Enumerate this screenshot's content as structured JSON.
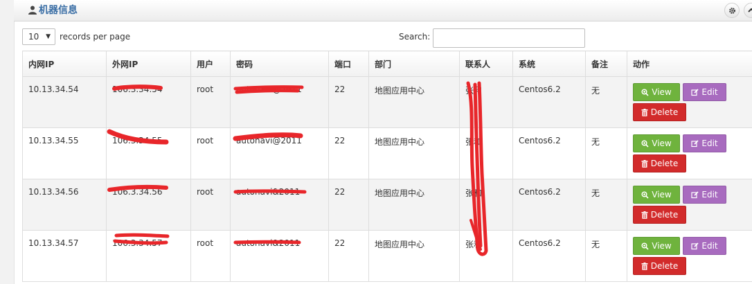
{
  "panel": {
    "title": "机器信息",
    "icon": "user-icon"
  },
  "header_buttons": [
    {
      "name": "gear-icon",
      "glyph": "⚙"
    },
    {
      "name": "chevron-up-icon",
      "glyph": "^"
    }
  ],
  "controls": {
    "length_value": "10",
    "length_label": "records per page",
    "search_label": "Search:",
    "search_value": ""
  },
  "table": {
    "columns": [
      "内网IP",
      "外网IP",
      "用户",
      "密码",
      "端口",
      "部门",
      "联系人",
      "系统",
      "备注",
      "动作"
    ],
    "rows": [
      {
        "internal_ip": "10.13.34.54",
        "external_ip": "106.3.34.54",
        "user": "root",
        "password": "autonavi@2011",
        "port": "22",
        "dept": "地图应用中心",
        "contact": "张和",
        "os": "Centos6.2",
        "note": "无"
      },
      {
        "internal_ip": "10.13.34.55",
        "external_ip": "106.3.34.55",
        "user": "root",
        "password": "autonavi@2011",
        "port": "22",
        "dept": "地图应用中心",
        "contact": "张和",
        "os": "Centos6.2",
        "note": "无"
      },
      {
        "internal_ip": "10.13.34.56",
        "external_ip": "106.3.34.56",
        "user": "root",
        "password": "autonavi&2011",
        "port": "22",
        "dept": "地图应用中心",
        "contact": "张和",
        "os": "Centos6.2",
        "note": "无"
      },
      {
        "internal_ip": "10.13.34.57",
        "external_ip": "106.3.34.57",
        "user": "root",
        "password": "autonavi&2011",
        "port": "22",
        "dept": "地图应用中心",
        "contact": "张和",
        "os": "Centos6.2",
        "note": "无"
      }
    ],
    "actions": {
      "view": "View",
      "edit": "Edit",
      "delete": "Delete"
    }
  },
  "colors": {
    "title": "#3a6ea5",
    "view": "#6fb33d",
    "edit": "#a86bbf",
    "delete": "#d22b2b",
    "redaction": "#e8262a"
  }
}
